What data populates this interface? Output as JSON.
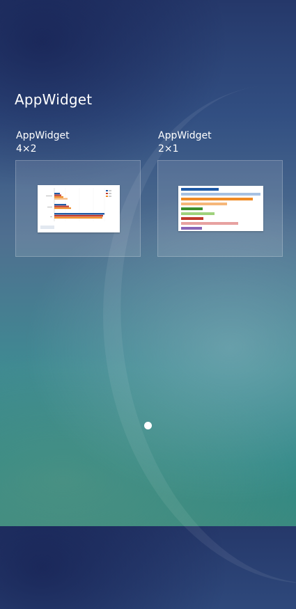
{
  "header": {
    "title": "AppWidget"
  },
  "widgets": [
    {
      "name": "AppWidget",
      "size": "4×2",
      "preview": "grouped-bar-chart-preview"
    },
    {
      "name": "AppWidget",
      "size": "2×1",
      "preview": "colored-bars-preview"
    }
  ],
  "pager": {
    "pages": 1,
    "current": 1
  },
  "colors": {
    "blue_dark": "#1f5aa6",
    "blue_light": "#a6c1e3",
    "orange": "#f08a24",
    "orange_light": "#f5b77a",
    "green": "#3a8f2c",
    "green_light": "#9fd27c",
    "red": "#c0392b",
    "pink": "#e7a1a0",
    "purple": "#8a64b8"
  }
}
